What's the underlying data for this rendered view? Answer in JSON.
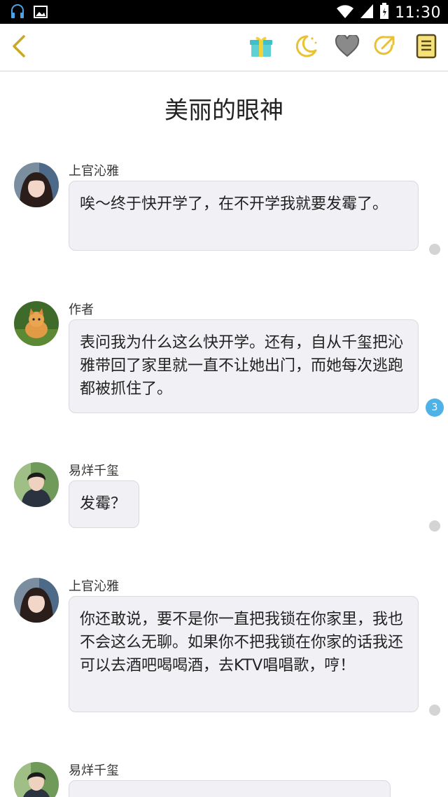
{
  "status_bar": {
    "time": "11:30",
    "icons": [
      "headset-icon",
      "image-icon",
      "wifi-icon",
      "signal-icon",
      "battery-icon"
    ]
  },
  "toolbar": {
    "back_icon": "chevron-left-icon",
    "actions": [
      "gift-icon",
      "moon-icon",
      "heart-icon",
      "share-icon",
      "notebook-icon"
    ],
    "accent_color": "#e8c233"
  },
  "story": {
    "title": "美丽的眼神"
  },
  "messages": [
    {
      "sender": "上官沁雅",
      "text": "唉～终于快开学了，在不开学我就要发霉了。",
      "indicator": ""
    },
    {
      "sender": "作者",
      "text": "表问我为什么这么快开学。还有，自从千玺把沁雅带回了家里就一直不让她出门，而她每次逃跑都被抓住了。",
      "indicator": "3"
    },
    {
      "sender": "易烊千玺",
      "text": "发霉？",
      "indicator": ""
    },
    {
      "sender": "上官沁雅",
      "text": "你还敢说，要不是你一直把我锁在你家里，我也不会这么无聊。如果你不把我锁在你家的话我还可以去酒吧喝喝酒，去KTV唱唱歌，哼！",
      "indicator": ""
    },
    {
      "sender": "易烊千玺",
      "text": "",
      "indicator": ""
    }
  ]
}
